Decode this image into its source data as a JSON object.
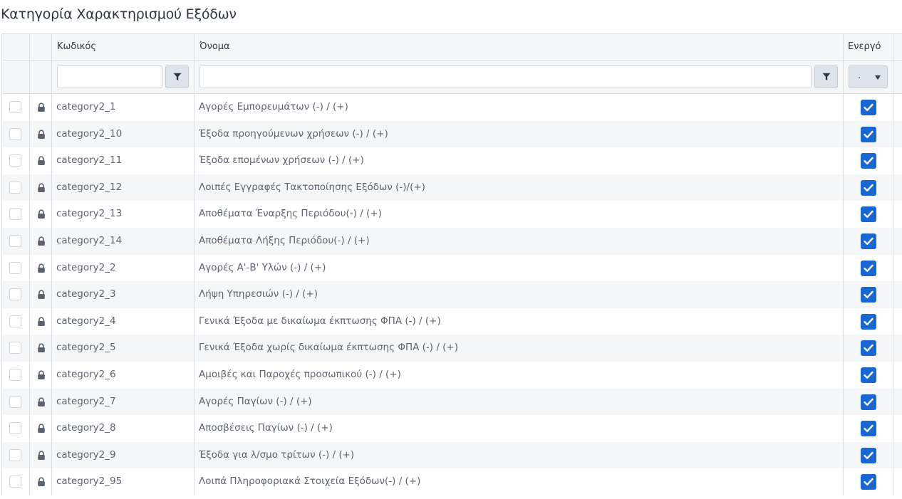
{
  "page": {
    "title": "Κατηγορία Χαρακτηρισμού Εξόδων"
  },
  "columns": {
    "code": "Κωδικός",
    "name": "Όνομα",
    "active": "Ενεργό"
  },
  "filters": {
    "code_value": "",
    "name_value": "",
    "active_value": "."
  },
  "icons": {
    "filter": "filter-funnel-icon",
    "lock": "lock-icon",
    "check": "checkmark-icon",
    "caret": "caret-down-icon"
  },
  "colors": {
    "accent": "#1967d2",
    "row_alt": "#f5f6f8",
    "header_bg": "#f6f7f9"
  },
  "rows": [
    {
      "code": "category2_1",
      "name": "Αγορές Εμπορευμάτων (-) / (+)",
      "active": true
    },
    {
      "code": "category2_10",
      "name": "Έξοδα προηγούμενων χρήσεων (-) / (+)",
      "active": true
    },
    {
      "code": "category2_11",
      "name": "Έξοδα επομένων χρήσεων (-) / (+)",
      "active": true
    },
    {
      "code": "category2_12",
      "name": "Λοιπές Εγγραφές Τακτοποίησης Εξόδων (-)/(+)",
      "active": true
    },
    {
      "code": "category2_13",
      "name": "Αποθέματα Έναρξης Περιόδου(-) / (+)",
      "active": true
    },
    {
      "code": "category2_14",
      "name": "Αποθέματα Λήξης Περιόδου(-) / (+)",
      "active": true
    },
    {
      "code": "category2_2",
      "name": "Αγορές Α'-Β' Υλών (-) / (+)",
      "active": true
    },
    {
      "code": "category2_3",
      "name": "Λήψη Υπηρεσιών (-) / (+)",
      "active": true
    },
    {
      "code": "category2_4",
      "name": "Γενικά Έξοδα με δικαίωμα έκπτωσης ΦΠΑ (-) / (+)",
      "active": true
    },
    {
      "code": "category2_5",
      "name": "Γενικά Έξοδα χωρίς δικαίωμα έκπτωσης ΦΠΑ (-) / (+)",
      "active": true
    },
    {
      "code": "category2_6",
      "name": "Αμοιβές και Παροχές προσωπικού (-) / (+)",
      "active": true
    },
    {
      "code": "category2_7",
      "name": "Αγορές Παγίων (-) / (+)",
      "active": true
    },
    {
      "code": "category2_8",
      "name": "Αποσβέσεις Παγίων (-) / (+)",
      "active": true
    },
    {
      "code": "category2_9",
      "name": "Έξοδα για λ/σμο τρίτων (-) / (+)",
      "active": true
    },
    {
      "code": "category2_95",
      "name": "Λοιπά Πληροφοριακά Στοιχεία Εξόδων(-) / (+)",
      "active": true
    }
  ]
}
